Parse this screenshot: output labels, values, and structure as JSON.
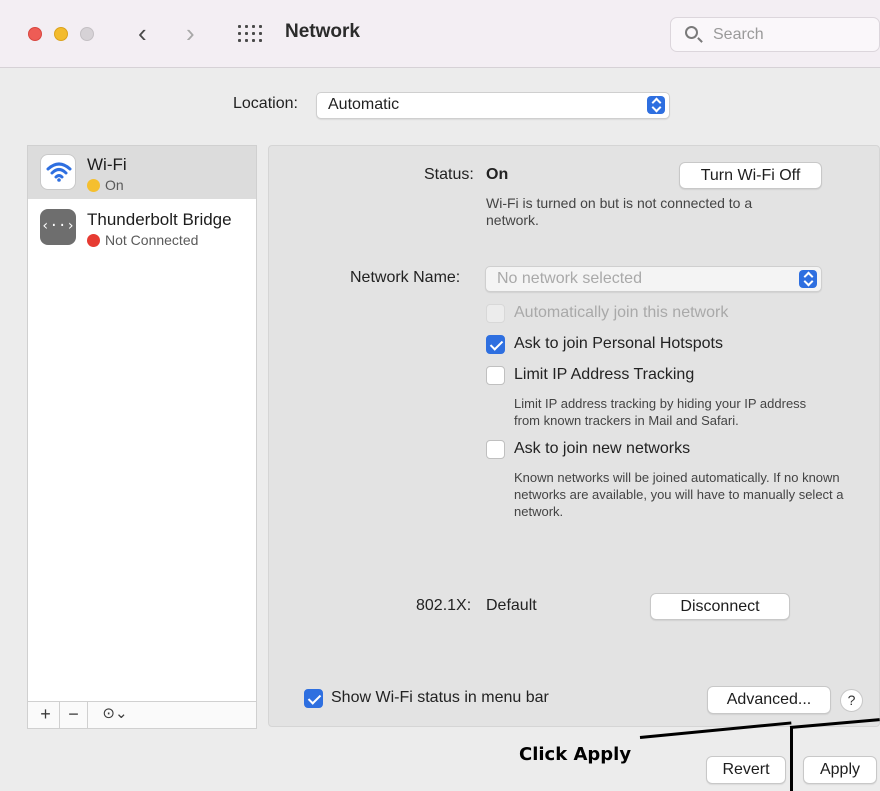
{
  "window": {
    "title": "Network",
    "search_placeholder": "Search"
  },
  "location": {
    "label": "Location:",
    "value": "Automatic"
  },
  "sidebar": {
    "services": [
      {
        "name": "Wi-Fi",
        "status": "On",
        "status_color": "#f5bf2e",
        "icon": "wifi-icon"
      },
      {
        "name": "Thunderbolt Bridge",
        "status": "Not Connected",
        "status_color": "#e63b32",
        "icon": "thunderbolt-bridge-icon"
      }
    ],
    "toolbar": {
      "add": "+",
      "remove": "−",
      "action": "⊙⌄"
    }
  },
  "wifi_panel": {
    "status_label": "Status:",
    "status_value": "On",
    "turn_off_button": "Turn Wi-Fi Off",
    "status_description": "Wi-Fi is turned on but is not connected to a network.",
    "network_name_label": "Network Name:",
    "network_name_placeholder": "No network selected",
    "options": [
      {
        "label": "Automatically join this network",
        "checked": false,
        "disabled": true
      },
      {
        "label": "Ask to join Personal Hotspots",
        "checked": true,
        "disabled": false
      },
      {
        "label": "Limit IP Address Tracking",
        "checked": false,
        "disabled": false
      },
      {
        "label": "Ask to join new networks",
        "checked": false,
        "disabled": false
      }
    ],
    "limit_ip_description": "Limit IP address tracking by hiding your IP address from known trackers in Mail and Safari.",
    "new_networks_description": "Known networks will be joined automatically. If no known networks are available, you will have to manually select a network.",
    "dot1x_label": "802.1X:",
    "dot1x_value": "Default",
    "disconnect_button": "Disconnect",
    "show_status_label": "Show Wi-Fi status in menu bar",
    "show_status_checked": true,
    "advanced_button": "Advanced...",
    "help_button": "?"
  },
  "footer": {
    "revert_button": "Revert",
    "apply_button": "Apply"
  },
  "annotation": {
    "text": "Click Apply"
  },
  "colors": {
    "accent": "#2e6fe0",
    "traffic_red": "#ee5c55",
    "traffic_yellow": "#f3bb2d"
  }
}
